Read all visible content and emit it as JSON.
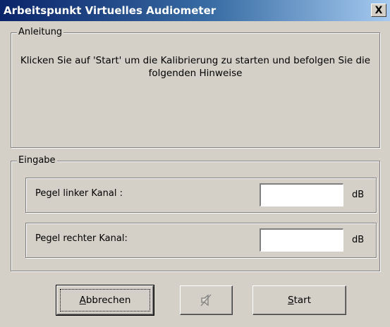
{
  "window": {
    "title": "Arbeitspunkt Virtuelles Audiometer",
    "close_label": "X"
  },
  "instructions": {
    "group_label": "Anleitung",
    "text": "Klicken Sie auf 'Start' um die Kalibrierung zu starten und befolgen Sie die folgenden Hinweise"
  },
  "input": {
    "group_label": "Eingabe",
    "fields": [
      {
        "label": "Pegel linker Kanal :",
        "value": "",
        "unit": "dB"
      },
      {
        "label": "Pegel rechter Kanal:",
        "value": "",
        "unit": "dB"
      }
    ]
  },
  "buttons": {
    "cancel": {
      "accel": "A",
      "rest": "bbrechen"
    },
    "mute_icon": "speaker-muted-icon",
    "start": {
      "accel": "S",
      "rest": "tart"
    }
  }
}
